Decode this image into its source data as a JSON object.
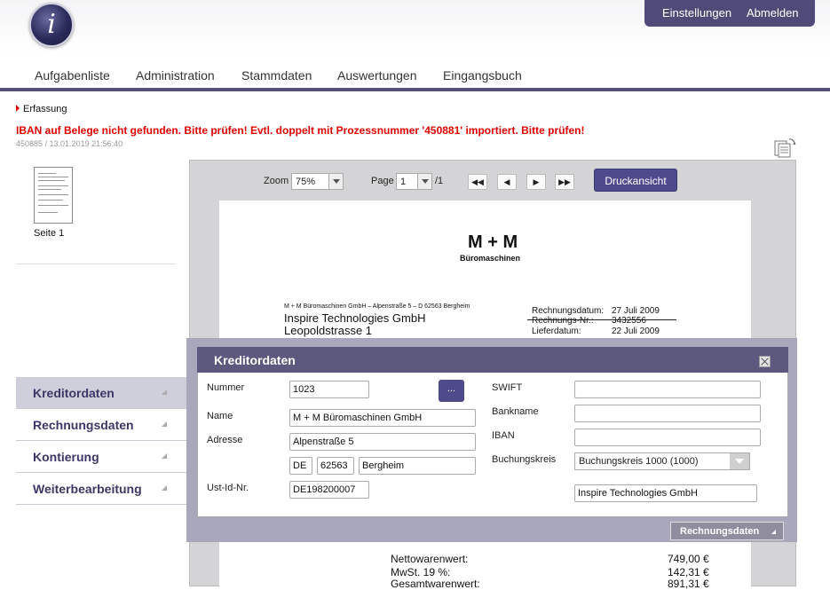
{
  "header": {
    "logo_glyph": "i",
    "top_links": {
      "settings": "Einstellungen",
      "logout": "Abmelden"
    },
    "nav": [
      "Aufgabenliste",
      "Administration",
      "Stammdaten",
      "Auswertungen",
      "Eingangsbuch"
    ]
  },
  "breadcrumb": "Erfassung",
  "error_message": "IBAN auf Belege nicht gefunden. Bitte prüfen! Evtl. doppelt mit Prozessnummer '450881' importiert. Bitte prüfen!",
  "process_info": "450885 / 13.01.2019 21:56:40",
  "thumbnail": {
    "label": "Seite 1"
  },
  "side_menu": [
    "Kreditordaten",
    "Rechnungsdaten",
    "Kontierung",
    "Weiterbearbeitung"
  ],
  "viewer": {
    "zoom_label": "Zoom",
    "zoom_value": "75%",
    "page_label": "Page",
    "page_value": "1",
    "page_total": "/1",
    "nav_first": "◀◀",
    "nav_prev": "◀",
    "nav_next": "▶",
    "nav_last": "▶▶",
    "print_button": "Druckansicht"
  },
  "document": {
    "company": "M + M",
    "company_sub": "Büromaschinen",
    "sender_line": "M + M Büromaschinen GmbH – Alpenstraße 5 – D 62563 Bergheim",
    "recipient": "Inspire Technologies GmbH",
    "street": "Leopoldstrasse 1",
    "meta": [
      {
        "label": "Rechnungsdatum:",
        "value": "27 Juli 2009"
      },
      {
        "label": "Rechnungs-Nr.:",
        "value": "3432556"
      },
      {
        "label": "Lieferdatum:",
        "value": "22 Juli 2009"
      }
    ],
    "totals": [
      {
        "label": "Nettowarenwert:",
        "value": "749,00 €"
      },
      {
        "label": "MwSt. 19 %:",
        "value": "142,31 €"
      },
      {
        "label": "Gesamtwarenwert:",
        "value": "891,31 €"
      }
    ]
  },
  "dialog": {
    "title": "Kreditordaten",
    "more_button": "...",
    "fields": {
      "nummer": {
        "label": "Nummer",
        "value": "1023"
      },
      "name": {
        "label": "Name",
        "value": "M + M Büromaschinen GmbH"
      },
      "adresse": {
        "label": "Adresse",
        "street": "Alpenstraße 5",
        "country": "DE",
        "zip": "62563",
        "city": "Bergheim"
      },
      "ustid": {
        "label": "Ust-Id-Nr.",
        "value": "DE198200007"
      },
      "swift": {
        "label": "SWIFT",
        "value": ""
      },
      "bankname": {
        "label": "Bankname",
        "value": ""
      },
      "iban": {
        "label": "IBAN",
        "value": ""
      },
      "buchungskreis": {
        "label": "Buchungskreis",
        "value": "Buchungskreis 1000 (1000)",
        "company": "Inspire Technologies GmbH"
      }
    },
    "next_button": "Rechnungsdaten"
  },
  "colors": {
    "accent": "#4f4a8c",
    "nav_bar": "#55507a",
    "error": "#e00000",
    "dialog_header": "#5c587e"
  }
}
